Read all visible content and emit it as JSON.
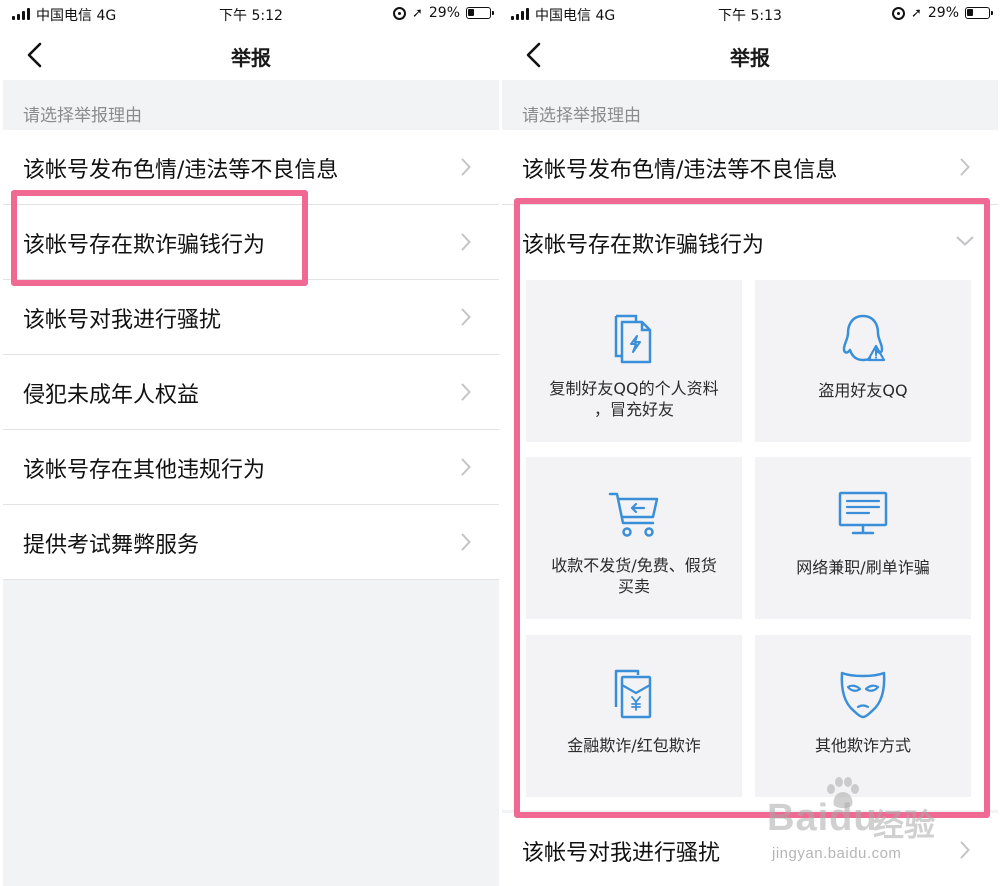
{
  "left": {
    "status": {
      "carrier": "中国电信  4G",
      "time": "下午 5:12",
      "battery": "29%"
    },
    "title": "举报",
    "section_header": "请选择举报理由",
    "items": [
      {
        "label": "该帐号发布色情/违法等不良信息"
      },
      {
        "label": "该帐号存在欺诈骗钱行为"
      },
      {
        "label": "该帐号对我进行骚扰"
      },
      {
        "label": "侵犯未成年人权益"
      },
      {
        "label": "该帐号存在其他违规行为"
      },
      {
        "label": "提供考试舞弊服务"
      }
    ]
  },
  "right": {
    "status": {
      "carrier": "中国电信  4G",
      "time": "下午 5:13",
      "battery": "29%"
    },
    "title": "举报",
    "section_header": "请选择举报理由",
    "items": [
      {
        "label": "该帐号发布色情/违法等不良信息"
      },
      {
        "label": "该帐号存在欺诈骗钱行为"
      },
      {
        "label": "该帐号对我进行骚扰"
      }
    ],
    "sub_options": [
      {
        "line1": "复制好友QQ的个人资料",
        "line2": "，冒充好友",
        "icon": "copy-profile-icon"
      },
      {
        "line1": "盗用好友QQ",
        "line2": "",
        "icon": "penguin-warning-icon"
      },
      {
        "line1": "收款不发货/免费、假货",
        "line2": "买卖",
        "icon": "shopping-cart-icon"
      },
      {
        "line1": "网络兼职/刷单诈骗",
        "line2": "",
        "icon": "monitor-icon"
      },
      {
        "line1": "金融欺诈/红包欺诈",
        "line2": "",
        "icon": "red-packet-icon"
      },
      {
        "line1": "其他欺诈方式",
        "line2": "",
        "icon": "mask-icon"
      }
    ]
  },
  "colors": {
    "accent_blue": "#3b8fd9",
    "highlight_pink": "#f06993",
    "chevron": "#c4c4c8"
  },
  "watermark": {
    "brand_a": "Bai",
    "brand_b": "du",
    "brand_cn": "经验",
    "url": "jingyan.baidu.com"
  }
}
